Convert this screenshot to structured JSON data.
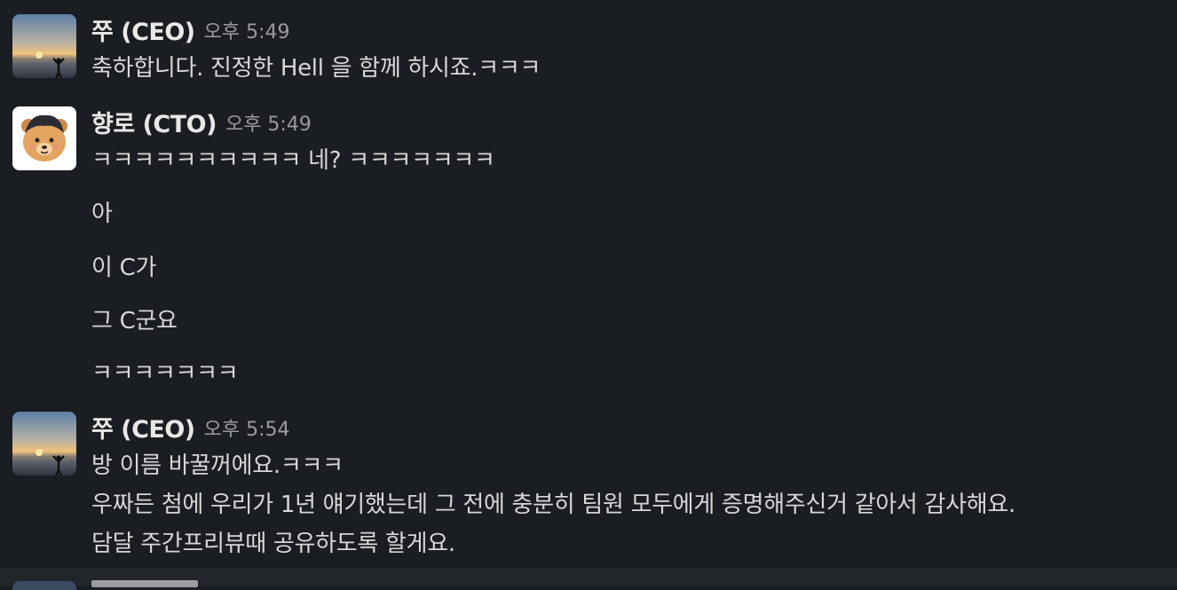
{
  "messages": [
    {
      "author": "쭈 (CEO)",
      "time": "오후 5:49",
      "lines": [
        "축하합니다. 진정한 Hell 을 함께 하시죠.ㅋㅋㅋ"
      ]
    },
    {
      "author": "향로 (CTO)",
      "time": "오후 5:49",
      "lines": [
        "ㅋㅋㅋㅋㅋㅋㅋㅋㅋㅋ 네? ㅋㅋㅋㅋㅋㅋㅋ",
        "아",
        "이 C가",
        "그 C군요",
        "ㅋㅋㅋㅋㅋㅋㅋ"
      ]
    },
    {
      "author": "쭈 (CEO)",
      "time": "오후 5:54",
      "lines": [
        "방 이름 바꿀꺼에요.ㅋㅋㅋ",
        "우짜든 첨에 우리가 1년 얘기했는데 그 전에 충분히 팀원 모두에게 증명해주신거 같아서 감사해요.",
        "담달 주간프리뷰때 공유하도록 할게요."
      ]
    }
  ]
}
